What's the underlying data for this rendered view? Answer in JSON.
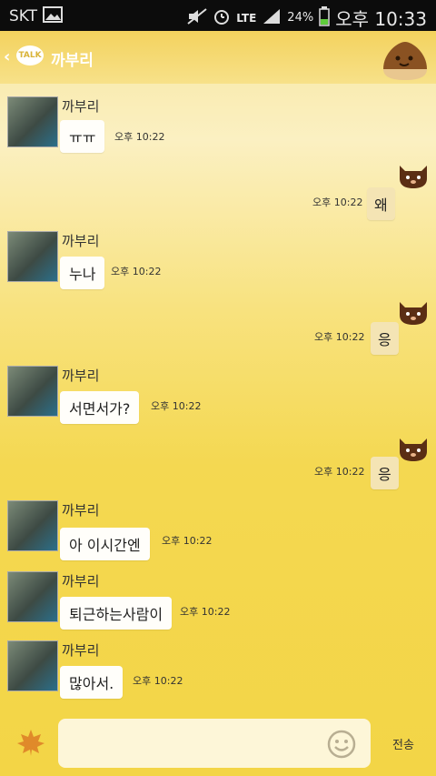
{
  "status_bar": {
    "carrier": "SKT",
    "network": "LTE",
    "battery_pct": "24%",
    "time": "오후 10:33"
  },
  "header": {
    "badge": "TALK",
    "title": "까부리"
  },
  "messages": [
    {
      "side": "in",
      "sender": "까부리",
      "text": "ㅠㅠ",
      "time": "오후 10:22"
    },
    {
      "side": "out",
      "text": "왜",
      "time": "오후 10:22"
    },
    {
      "side": "in",
      "sender": "까부리",
      "text": "누나",
      "time": "오후 10:22"
    },
    {
      "side": "out",
      "text": "응",
      "time": "오후 10:22"
    },
    {
      "side": "in",
      "sender": "까부리",
      "text": "서면서가?",
      "time": "오후 10:22"
    },
    {
      "side": "out",
      "text": "응",
      "time": "오후 10:22"
    },
    {
      "side": "in",
      "sender": "까부리",
      "text": "아 이시간엔",
      "time": "오후 10:22"
    },
    {
      "side": "in",
      "sender": "까부리",
      "text": "퇴근하는사람이",
      "time": "오후 10:22"
    },
    {
      "side": "in",
      "sender": "까부리",
      "text": "많아서.",
      "time": "오후 10:22"
    }
  ],
  "input": {
    "placeholder": "",
    "send_label": "전송"
  },
  "icons": {
    "back": "chevron-left-icon",
    "emoji": "emoticon-icon",
    "leaf": "maple-leaf-icon",
    "chestnut": "chestnut-character-icon",
    "cat": "cat-character-icon"
  }
}
